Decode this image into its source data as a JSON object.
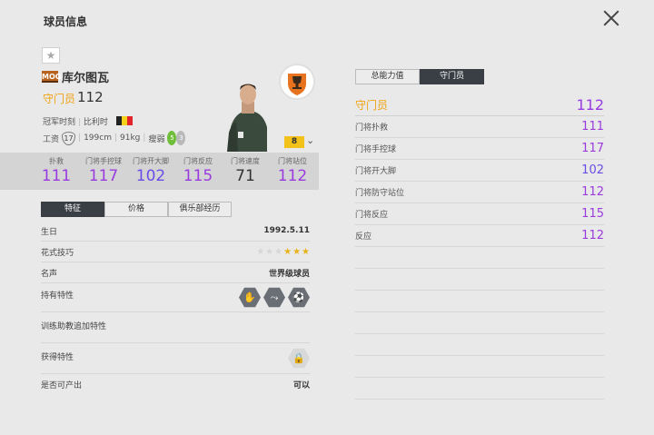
{
  "header": {
    "title": "球员信息"
  },
  "player": {
    "season_badge": "MOG",
    "name": "库尔图瓦",
    "position": "守门员",
    "overall": "112",
    "club": "冠军时刻",
    "nation": "比利时",
    "salary_label": "工资",
    "salary": "17",
    "height": "199cm",
    "weight": "91kg",
    "body_type": "瘦弱",
    "left_foot": "5",
    "right_foot": "3",
    "level": "8"
  },
  "stats": [
    {
      "label": "扑救",
      "value": "111",
      "color": "#9a3be0"
    },
    {
      "label": "门将手控球",
      "value": "117",
      "color": "#9a3be0"
    },
    {
      "label": "门将开大脚",
      "value": "102",
      "color": "#6a4de6"
    },
    {
      "label": "门将反应",
      "value": "115",
      "color": "#9a3be0"
    },
    {
      "label": "门将速度",
      "value": "71",
      "color": "#333333"
    },
    {
      "label": "门将站位",
      "value": "112",
      "color": "#9a3be0"
    }
  ],
  "tabs": [
    "特征",
    "价格",
    "俱乐部经历"
  ],
  "info": {
    "birthday_label": "生日",
    "birthday": "1992.5.11",
    "skill_label": "花式技巧",
    "fame_label": "名声",
    "fame": "世界级球员",
    "traits_label": "持有特性",
    "coach_label": "训练助教追加特性",
    "acquire_label": "获得特性",
    "produce_label": "是否可产出",
    "produce": "可以"
  },
  "right_tabs": [
    "总能力值",
    "守门员"
  ],
  "right_header": {
    "label": "守门员",
    "value": "112"
  },
  "right_rows": [
    {
      "label": "门将扑救",
      "value": "111",
      "color": "#9a3be0"
    },
    {
      "label": "门将手控球",
      "value": "117",
      "color": "#9a3be0"
    },
    {
      "label": "门将开大脚",
      "value": "102",
      "color": "#6a4de6"
    },
    {
      "label": "门将防守站位",
      "value": "112",
      "color": "#9a3be0"
    },
    {
      "label": "门将反应",
      "value": "115",
      "color": "#9a3be0"
    },
    {
      "label": "反应",
      "value": "112",
      "color": "#9a3be0"
    }
  ]
}
